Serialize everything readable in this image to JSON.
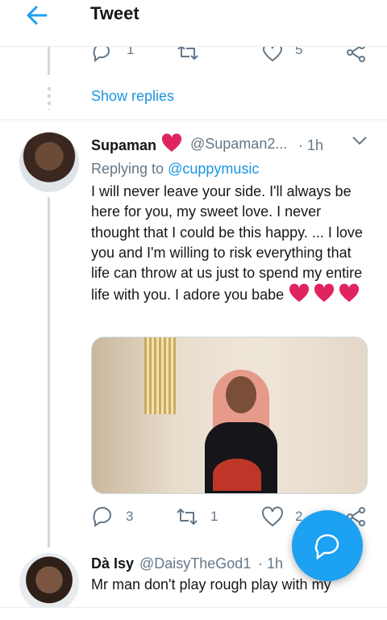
{
  "header": {
    "title": "Tweet"
  },
  "prev_tweet": {
    "reply_count": "1",
    "like_count": "5"
  },
  "show_replies": "Show replies",
  "tweet": {
    "name": "Supaman",
    "handle": "@Supaman2...",
    "time": "· 1h",
    "replying_label": "Replying to",
    "replying_to": "@cuppymusic",
    "text": "I will never leave your side. I'll always be here for you, my sweet love. I never thought that I could be this happy. ... I love you and I'm willing to risk everything that life can throw at us just to spend my entire life with you. I adore you babe",
    "reply_count": "3",
    "retweet_count": "1",
    "like_count": "2"
  },
  "next_tweet": {
    "name": "Dà Isy",
    "handle": "@DaisyTheGod1",
    "time": "· 1h",
    "text": "Mr man don't play rough play with my"
  },
  "colors": {
    "accent": "#1da1f2",
    "heart": "#e0245e",
    "muted": "#657786"
  },
  "icons": [
    "back-arrow-icon",
    "reply-icon",
    "retweet-icon",
    "like-icon",
    "share-icon",
    "chevron-down-icon",
    "compose-icon",
    "heart-emoji-icon"
  ]
}
